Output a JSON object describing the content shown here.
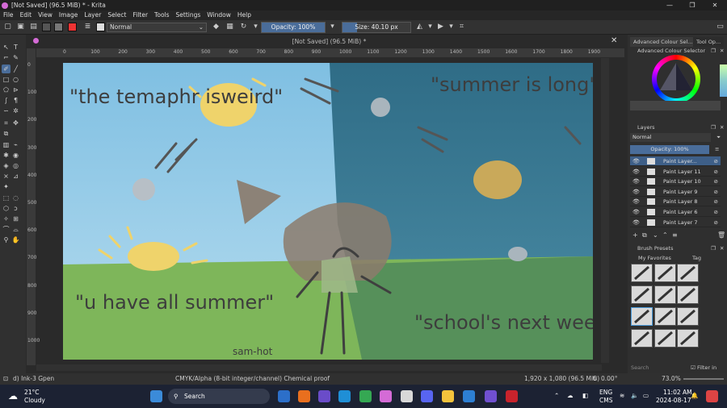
{
  "window": {
    "title": "[Not Saved]  (96.5 MiB) * - Krita"
  },
  "menu": [
    "File",
    "Edit",
    "View",
    "Image",
    "Layer",
    "Select",
    "Filter",
    "Tools",
    "Settings",
    "Window",
    "Help"
  ],
  "toolbar": {
    "blend_mode": "Normal",
    "opacity": "Opacity: 100%",
    "opacity_pct": 100,
    "size": "Size: 40.10 px",
    "size_fill": 0.22
  },
  "document": {
    "tab_title": "[Not Saved]  (96.5 MiB) *"
  },
  "ruler": {
    "h_ticks": [
      "0",
      "100",
      "200",
      "300",
      "400",
      "500",
      "600",
      "700",
      "800",
      "900",
      "1000",
      "1100",
      "1200",
      "1300",
      "1400",
      "1500",
      "1600",
      "1700",
      "1800",
      "1900"
    ],
    "v_ticks": [
      "0",
      "100",
      "200",
      "300",
      "400",
      "500",
      "600",
      "700",
      "800",
      "900",
      "1000"
    ]
  },
  "canvas_text": {
    "top_left": "\"the temaphr isweird\"",
    "top_right": "\"summer is long\"",
    "bottom_left": "\"u have all summer\"",
    "bottom_right": "\"school's next week\"",
    "signature": "sam-hot"
  },
  "panels": {
    "tabs": [
      "Advanced Colour Sel...",
      "Tool Op..."
    ],
    "colour_selector": "Advanced Colour Selector",
    "layers_title": "Layers",
    "layers_blend": "Normal",
    "layers_opacity": "Opacity:  100%",
    "layers": [
      {
        "name": "Paint Layer..."
      },
      {
        "name": "Paint Layer 11"
      },
      {
        "name": "Paint Layer 10"
      },
      {
        "name": "Paint Layer 9"
      },
      {
        "name": "Paint Layer 8"
      },
      {
        "name": "Paint Layer 6"
      },
      {
        "name": "Paint Layer 7"
      }
    ],
    "brush_presets_title": "Brush Presets",
    "brush_filter": "My Favorites",
    "brush_tag": "Tag",
    "search_placeholder": "Search",
    "filter_in_tag": "Filter in Tag"
  },
  "status": {
    "brush": "d) Ink-3 Gpen",
    "colorspace": "CMYK/Alpha (8-bit integer/channel)  Chemical proof",
    "dimensions": "1,920 x 1,080 (96.5 MiB)",
    "rotation": "0.00°",
    "zoom": "73.0%"
  },
  "taskbar": {
    "weather_temp": "21°C",
    "weather_desc": "Cloudy",
    "search": "Search",
    "lang1": "ENG",
    "lang2": "CMS",
    "time": "11:02 AM",
    "date": "2024-08-17"
  },
  "colors": {
    "accent": "#4a6d9a",
    "sky_left": "#8fc6e3",
    "sky_right": "#3a7590",
    "grass": "#7fb85a",
    "sun": "#f0d46a"
  }
}
